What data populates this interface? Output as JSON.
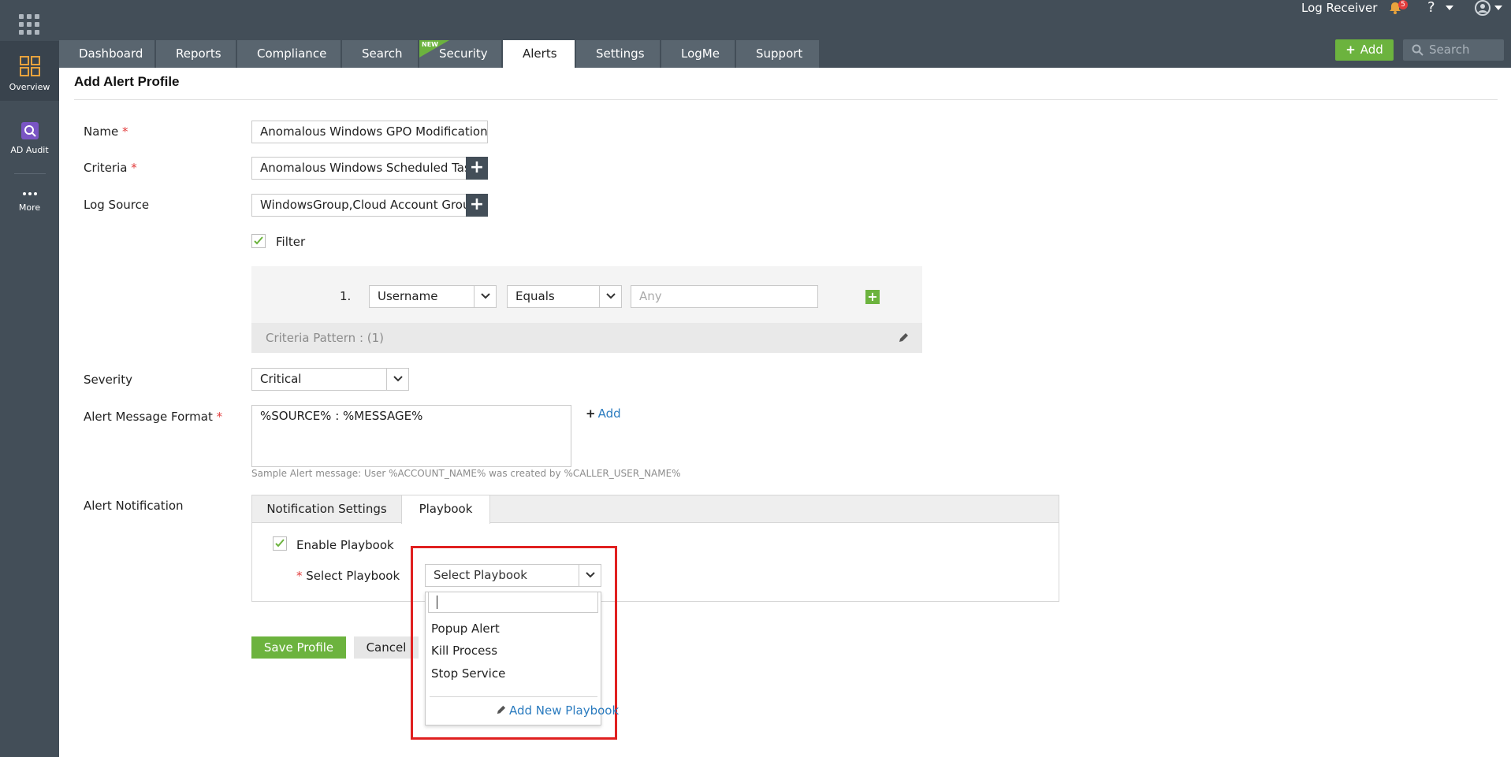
{
  "topbar": {
    "log_receiver": "Log Receiver",
    "notification_count": "5",
    "help": "?",
    "add_button": "Add",
    "search_placeholder": "Search"
  },
  "sidebar": {
    "items": [
      {
        "label": "Overview",
        "icon": "overview-grid-icon"
      },
      {
        "label": "AD Audit",
        "icon": "ad-audit-icon"
      },
      {
        "label": "More",
        "icon": "more-dots-icon"
      }
    ]
  },
  "tabs": [
    {
      "label": "Dashboard"
    },
    {
      "label": "Reports"
    },
    {
      "label": "Compliance"
    },
    {
      "label": "Search"
    },
    {
      "label": "Security",
      "flag": "NEW"
    },
    {
      "label": "Alerts",
      "active": true
    },
    {
      "label": "Settings"
    },
    {
      "label": "LogMe"
    },
    {
      "label": "Support"
    }
  ],
  "page": {
    "title": "Add Alert Profile"
  },
  "form": {
    "name_label": "Name",
    "name_value": "Anomalous Windows GPO Modification",
    "criteria_label": "Criteria",
    "criteria_value": "Anomalous Windows Scheduled Task",
    "log_source_label": "Log Source",
    "log_source_value": "WindowsGroup,Cloud Account Group",
    "filter_label": "Filter",
    "filter_row": {
      "index": "1.",
      "field": "Username",
      "operator": "Equals",
      "value_placeholder": "Any"
    },
    "criteria_pattern": "Criteria Pattern : (1)",
    "severity_label": "Severity",
    "severity_value": "Critical",
    "message_format_label": "Alert Message Format",
    "message_format_value": "%SOURCE% : %MESSAGE%",
    "add_link": "Add",
    "sample_hint": "Sample Alert message: User %ACCOUNT_NAME% was created by %CALLER_USER_NAME%",
    "notification_label": "Alert Notification",
    "notification_tabs": [
      "Notification Settings",
      "Playbook"
    ],
    "enable_playbook_label": "Enable Playbook",
    "select_playbook_label": "Select Playbook",
    "select_playbook_value": "Select Playbook",
    "playbook_options": [
      "Popup Alert",
      "Kill Process",
      "Stop Service"
    ],
    "add_new_playbook": "Add New Playbook",
    "save_button": "Save Profile",
    "cancel_button": "Cancel",
    "required_mark": "*"
  },
  "colors": {
    "nav_bg": "#434e58",
    "tab_bg": "#59656f",
    "accent_green": "#6cb33e",
    "link_blue": "#2a7bbf",
    "highlight_red": "#e02020",
    "required_red": "#e23c3c"
  }
}
